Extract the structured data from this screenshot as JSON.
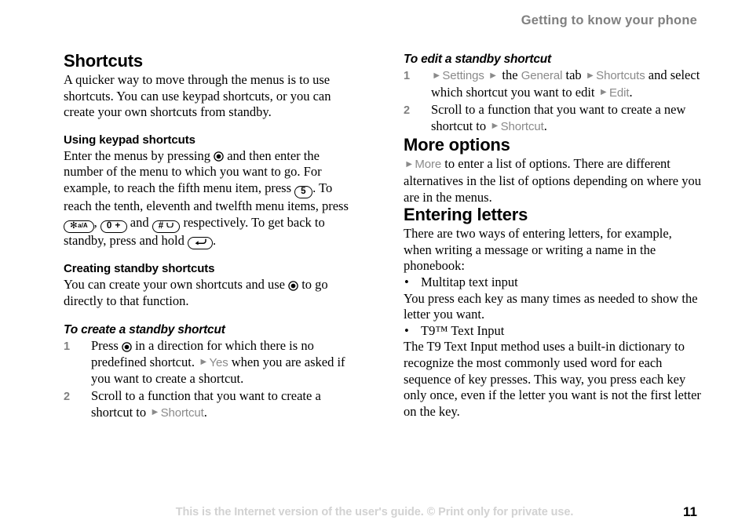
{
  "header": {
    "running_title": "Getting to know your phone"
  },
  "footer": {
    "note": "This is the Internet version of the user's guide. © Print only for private use.",
    "page_number": "11"
  },
  "left_column": {
    "section_title": "Shortcuts",
    "intro": "A quicker way to move through the menus is to use shortcuts. You can use keypad shortcuts, or you can create your own shortcuts from standby.",
    "keypad": {
      "heading": "Using keypad shortcuts",
      "text_1": "Enter the menus by pressing",
      "text_2": "and then enter the number of the menu to which you want to go. For example, to reach the fifth menu item, press",
      "key_five": "5",
      "text_3": ". To reach the tenth, eleventh and twelfth menu items, press",
      "key_star_main": "✻",
      "key_star_sub": "a/A",
      "key_zero_main": "0",
      "key_zero_sub": "+",
      "key_hash_main": "#",
      "text_4": ", ",
      "text_5": "and",
      "text_6": "respectively. To get back to standby, press and hold",
      "text_7": "."
    },
    "creating": {
      "heading": "Creating standby shortcuts",
      "text_1": "You can create your own shortcuts and use",
      "text_2": "to go directly to that function."
    },
    "procedure": {
      "heading": "To create a standby shortcut",
      "steps": [
        {
          "num": "1",
          "text_1": "Press",
          "text_2": "in a direction for which there is no predefined shortcut.",
          "ui_1": "Yes",
          "text_3": "when you are asked if you want to create a shortcut."
        },
        {
          "num": "2",
          "text_1": "Scroll to a function that you want to create a shortcut to",
          "ui_1": "Shortcut",
          "text_2": "."
        }
      ]
    }
  },
  "right_column": {
    "procedure": {
      "heading": "To edit a standby shortcut",
      "steps": [
        {
          "num": "1",
          "ui_1": "Settings",
          "text_1": "the",
          "ui_2": "General",
          "text_2": "tab",
          "ui_3": "Shortcuts",
          "text_3": "and select which shortcut you want to edit",
          "ui_4": "Edit",
          "text_4": "."
        },
        {
          "num": "2",
          "text_1": "Scroll to a function that you want to create a new shortcut to",
          "ui_1": "Shortcut",
          "text_2": "."
        }
      ]
    },
    "more_options": {
      "heading": "More options",
      "ui_1": "More",
      "text_1": "to enter a list of options. There are different alternatives in the list of options depending on where you are in the menus."
    },
    "entering_letters": {
      "heading": "Entering letters",
      "intro": "There are two ways of entering letters, for example, when writing a message or writing a name in the phonebook:",
      "bullet_1": "Multitap text input",
      "para_1": "You press each key as many times as needed to show the letter you want.",
      "bullet_2": "T9™ Text Input",
      "para_2": "The T9 Text Input method uses a built-in dictionary to recognize the most commonly used word for each sequence of key presses. This way, you press each key only once, even if the letter you want is not the first letter on the key.",
      "bullet_glyph": "•"
    }
  },
  "icons": {
    "arrow_glyph": "►",
    "joystick": "joystick-select-key",
    "back_key": "back-key"
  },
  "colors": {
    "text": "#000000",
    "ui_term_gray": "#8a8a8a",
    "header_gray": "#808080",
    "footer_gray": "#d2d2d2"
  }
}
